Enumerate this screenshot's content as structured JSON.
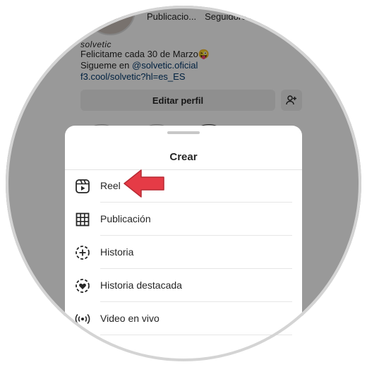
{
  "profile": {
    "stats": [
      "Publicacio...",
      "Seguidores"
    ],
    "username": "solvetic",
    "bio_line1": "Felicitame cada 30 de Marzo😜",
    "bio_line2_prefix": "Sigueme en ",
    "bio_line2_link": "@solvetic.oficial",
    "bio_line3": "f3.cool/solvetic?hl=es_ES",
    "edit_button": "Editar perfil"
  },
  "sheet": {
    "title": "Crear",
    "items": [
      {
        "label": "Reel",
        "icon": "reel-icon"
      },
      {
        "label": "Publicación",
        "icon": "grid-icon"
      },
      {
        "label": "Historia",
        "icon": "story-add-icon"
      },
      {
        "label": "Historia destacada",
        "icon": "highlight-heart-icon"
      },
      {
        "label": "Video en vivo",
        "icon": "live-icon"
      }
    ]
  },
  "annotation": {
    "color": "#e53b46",
    "icon": "red-arrow-pointer"
  }
}
